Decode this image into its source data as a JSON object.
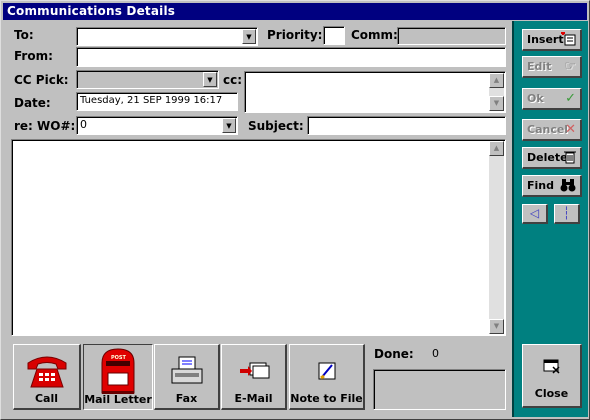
{
  "window": {
    "title": "Communications  Details"
  },
  "form": {
    "to_label": "To:",
    "to_value": "",
    "priority_label": "Priority:",
    "priority_value": "",
    "comm_label": "Comm:",
    "comm_value": "",
    "from_label": "From:",
    "from_value": "",
    "ccpick_label": "CC Pick:",
    "ccpick_value": "",
    "cc_label": "cc:",
    "cc_value": "",
    "date_label": "Date:",
    "date_value": "Tuesday, 21 SEP 1999   16:17",
    "wo_label": "re: WO#:",
    "wo_value": "0",
    "subject_label": "Subject:",
    "subject_value": "",
    "body_value": ""
  },
  "actions": {
    "insert": "Insert",
    "edit": "Edit",
    "ok": "Ok",
    "cancel": "Cancel",
    "delete": "Delete",
    "find": "Find",
    "close": "Close"
  },
  "comm_types": {
    "call": "Call",
    "mail_letter": "Mail Letter",
    "fax": "Fax",
    "email": "E-Mail",
    "note_to_file": "Note to File"
  },
  "status": {
    "done_label": "Done:",
    "done_value": "0"
  },
  "icons": {
    "insert": "insert-icon",
    "edit": "edit-hand-icon",
    "ok": "checkmark-icon",
    "cancel": "x-icon",
    "delete": "trash-icon",
    "find": "binoculars-icon",
    "close": "close-window-icon",
    "call": "telephone-icon",
    "mail_letter": "mailbox-icon",
    "fax": "fax-icon",
    "email": "email-icon",
    "note_to_file": "note-icon"
  },
  "colors": {
    "titlebar": "#000080",
    "sidebar": "#008080",
    "face": "#c0c0c0",
    "phone": "#d80000"
  }
}
